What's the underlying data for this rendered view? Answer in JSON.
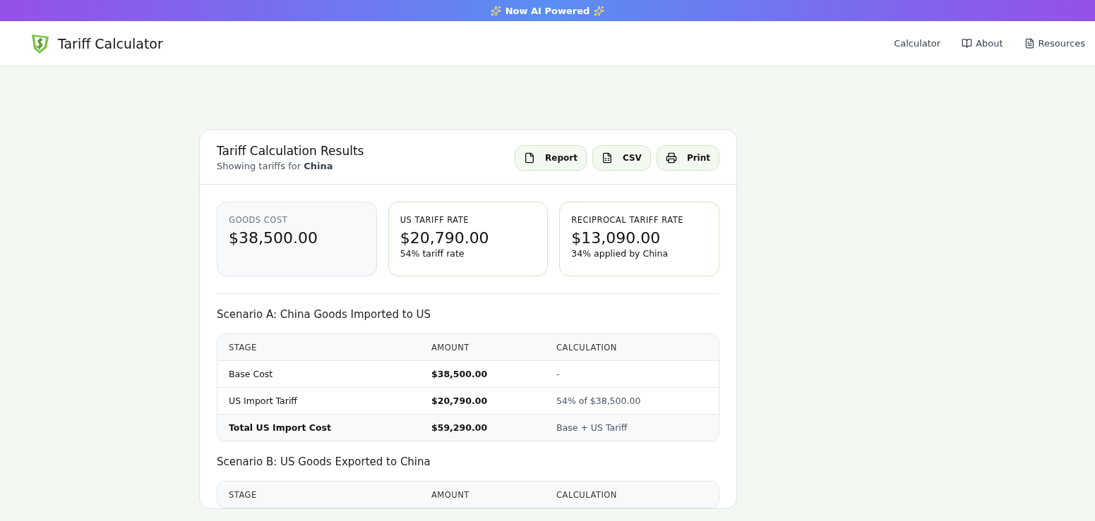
{
  "banner": {
    "text": "Now AI Powered"
  },
  "header": {
    "title": "Tariff Calculator",
    "nav": [
      {
        "label": "Calculator"
      },
      {
        "label": "About"
      },
      {
        "label": "Resources"
      }
    ]
  },
  "results": {
    "title": "Tariff Calculation Results",
    "subtitle": "Showing tariffs for **China**",
    "actions": [
      {
        "label": "Report"
      },
      {
        "label": "CSV"
      },
      {
        "label": "Print"
      }
    ],
    "summary": [
      {
        "kind": "muted",
        "label": "GOODS COST",
        "value": "$38,500.00"
      },
      {
        "kind": "accent",
        "label": "US TARIFF RATE",
        "value": "$20,790.00",
        "note": "54% tariff rate"
      },
      {
        "kind": "accent",
        "label": "RECIPROCAL TARIFF RATE",
        "value": "$13,090.00",
        "note": "34% applied by China"
      }
    ],
    "scenarios": [
      {
        "title": "Scenario A: China Goods Imported to US",
        "columns": [
          "STAGE",
          "AMOUNT",
          "CALCULATION"
        ],
        "rows": [
          {
            "total": false,
            "cells": [
              "Base Cost",
              "$38,500.00",
              "-"
            ]
          },
          {
            "total": false,
            "cells": [
              "US Import Tariff",
              "$20,790.00",
              "54% of $38,500.00"
            ]
          },
          {
            "total": true,
            "cells": [
              "Total US Import Cost",
              "$59,290.00",
              "Base + US Tariff"
            ]
          }
        ]
      },
      {
        "title": "Scenario B: US Goods Exported to China",
        "columns": [
          "STAGE",
          "AMOUNT",
          "CALCULATION"
        ]
      }
    ]
  }
}
